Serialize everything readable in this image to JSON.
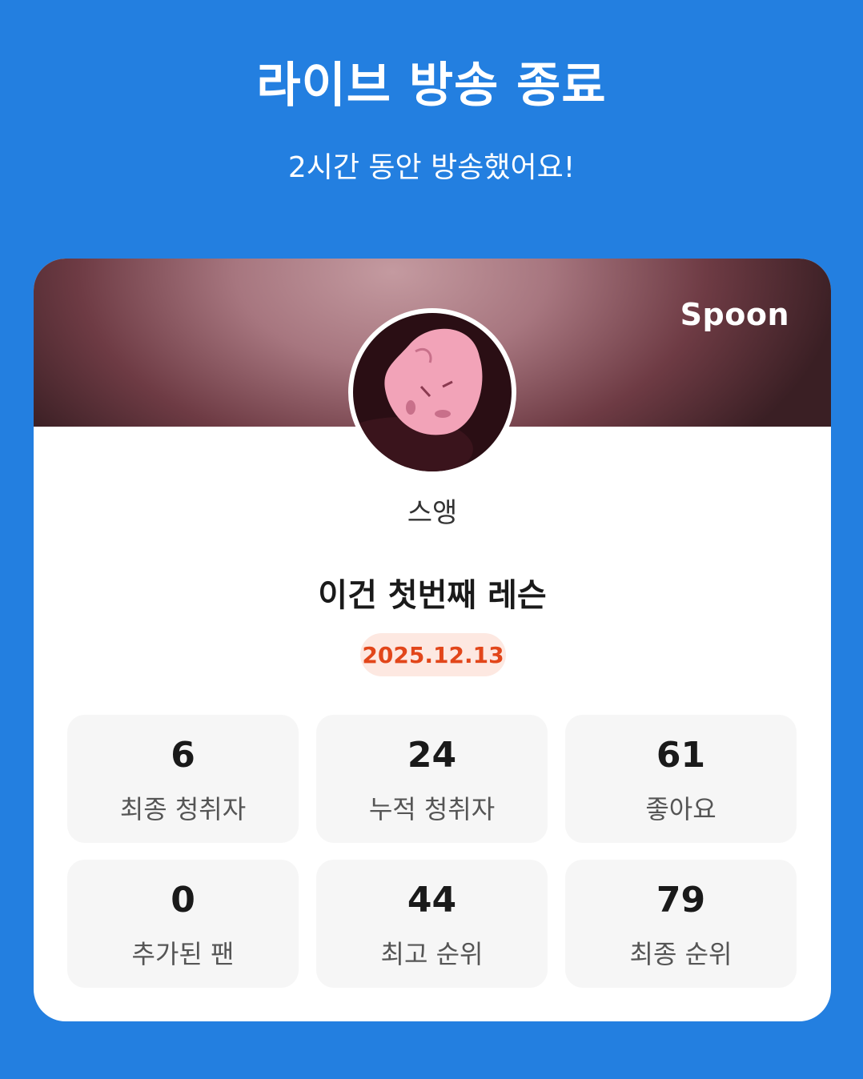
{
  "header": {
    "title": "라이브 방송 종료",
    "subtitle": "2시간 동안 방송했어요!"
  },
  "card": {
    "brand": "Spoon",
    "nickname": "스앵",
    "live_title": "이건 첫번째 레슨",
    "date": "2025.12.13",
    "stats": [
      {
        "value": "6",
        "label": "최종 청취자"
      },
      {
        "value": "24",
        "label": "누적 청취자"
      },
      {
        "value": "61",
        "label": "좋아요"
      },
      {
        "value": "0",
        "label": "추가된 팬"
      },
      {
        "value": "44",
        "label": "최고 순위"
      },
      {
        "value": "79",
        "label": "최종 순위"
      }
    ]
  },
  "colors": {
    "background": "#237fe0",
    "date_badge_bg": "#fde8e1",
    "date_badge_text": "#e2461a"
  }
}
